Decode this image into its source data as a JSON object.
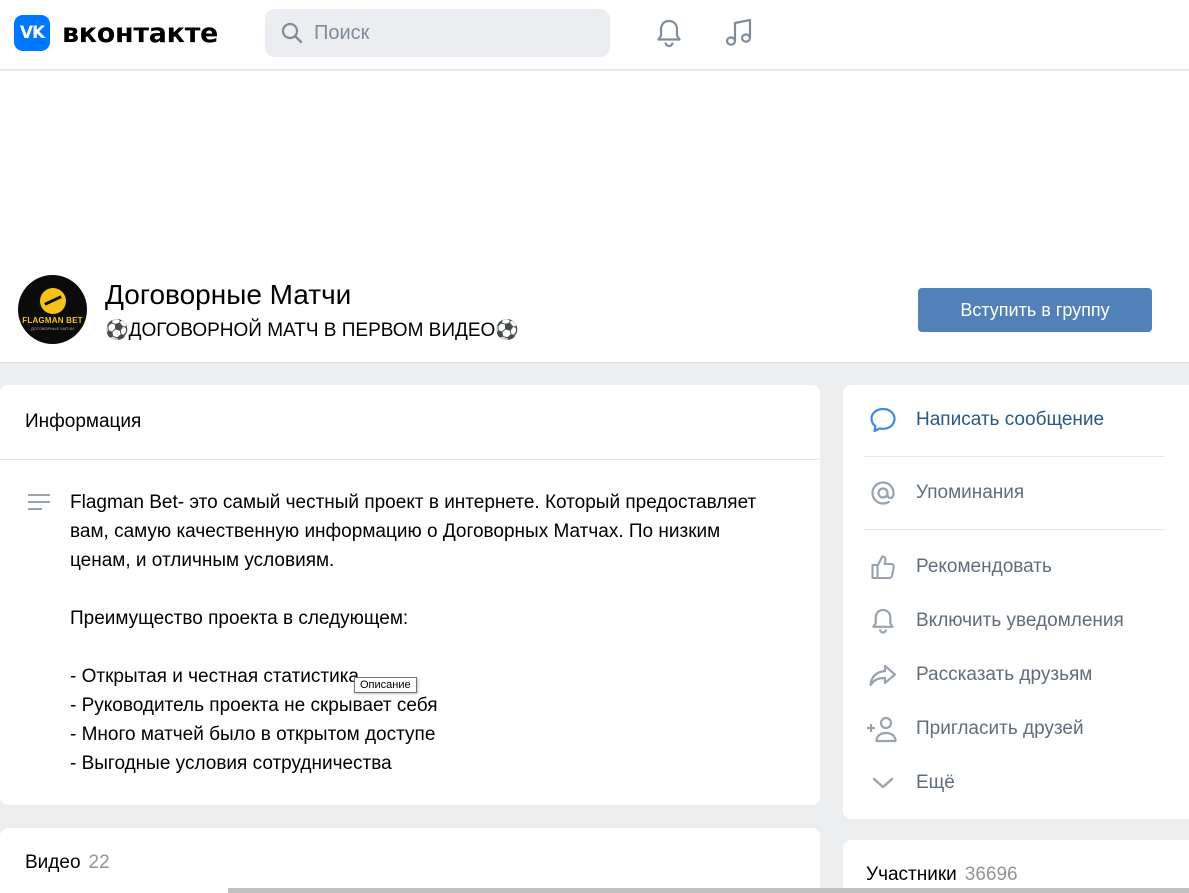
{
  "header": {
    "logo_mark": "VK",
    "logo_text": "вконтакте",
    "search_placeholder": "Поиск",
    "icons": [
      "search-icon",
      "bell-icon",
      "music-icon"
    ]
  },
  "group": {
    "avatar_text": "FLAGMAN BET",
    "avatar_subtext": "ДОГОВОРНЫЕ МАТЧИ",
    "title": "Договорные Матчи",
    "status": "⚽ДОГОВОРНОЙ МАТЧ В ПЕРВОМ ВИДЕО⚽",
    "join_label": "Вступить в группу"
  },
  "info": {
    "heading": "Информация",
    "description": [
      "Flagman Bet- это самый честный проект в интернете. Который предоставляет",
      "вам, самую качественную информацию о Договорных Матчах. По низким",
      "ценам, и отличным условиям.",
      "",
      "Преимущество проекта в следующем:",
      "",
      "- Открытая и честная статистика",
      "- Руководитель проекта не скрывает себя",
      "- Много матчей было в открытом доступе",
      "- Выгодные условия сотрудничества"
    ],
    "tooltip": "Описание"
  },
  "video": {
    "label": "Видео",
    "count": "22"
  },
  "side_menu": {
    "items": [
      {
        "label": "Написать сообщение",
        "icon": "message-icon"
      },
      {
        "label": "Упоминания",
        "icon": "at-icon"
      },
      {
        "label": "Рекомендовать",
        "icon": "thumbs-up-icon"
      },
      {
        "label": "Включить уведомления",
        "icon": "bell-icon"
      },
      {
        "label": "Рассказать друзьям",
        "icon": "share-icon"
      },
      {
        "label": "Пригласить друзей",
        "icon": "add-user-icon"
      },
      {
        "label": "Ещё",
        "icon": "chevron-down-icon"
      }
    ]
  },
  "members": {
    "label": "Участники",
    "count": "36696"
  },
  "colors": {
    "accent": "#5181b8",
    "link": "#2a5885",
    "logo": "#0077ff",
    "muted": "#626d7a"
  }
}
